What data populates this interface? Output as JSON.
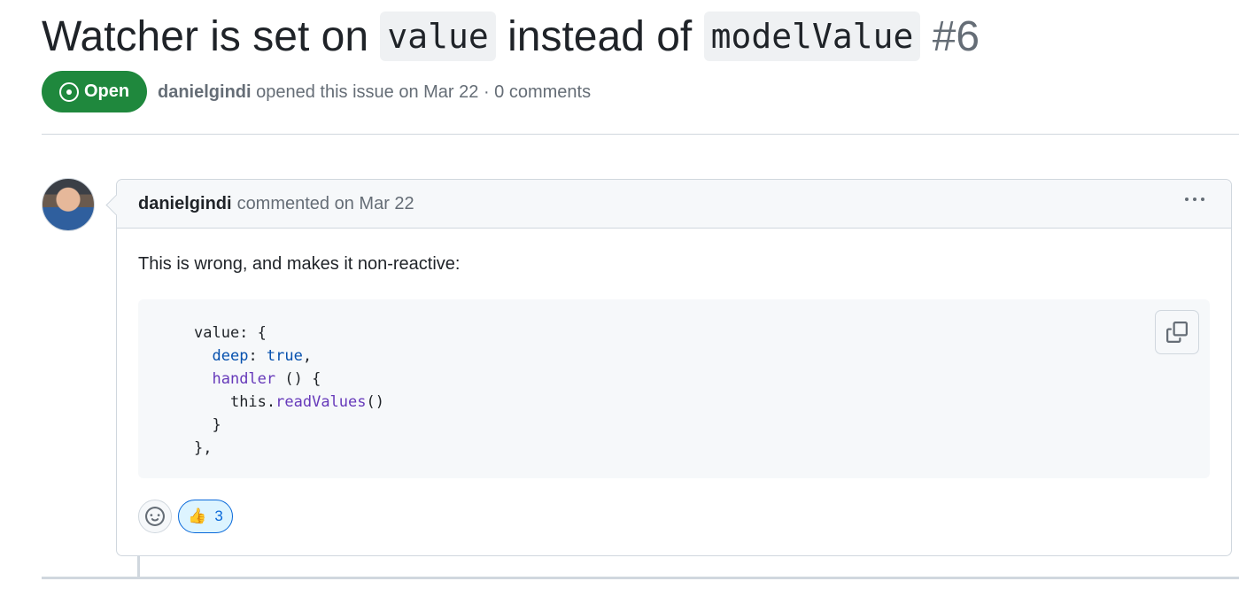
{
  "issue": {
    "title_part1": "Watcher is set on",
    "title_code1": "value",
    "title_part2": "instead of",
    "title_code2": "modelValue",
    "number": "#6",
    "state": "Open",
    "author": "danielgindi",
    "meta_text": "opened this issue on Mar 22 · 0 comments"
  },
  "comment": {
    "author": "danielgindi",
    "meta_text": "commented on Mar 22",
    "body": "This is wrong, and makes it non-reactive:",
    "code": {
      "line1": "value: {",
      "line2_key": "deep",
      "line2_value": "true",
      "line3_key": "handler",
      "line3_rest": " () {",
      "line4_this": "this.",
      "line4_fn": "readValues",
      "line4_rest": "()",
      "line5": "}",
      "line6": "},"
    },
    "reactions": [
      {
        "emoji": "👍",
        "icon": "thumbs-up-icon",
        "count": "3"
      }
    ]
  },
  "icons": {
    "state": "issue-opened-icon",
    "kebab": "kebab-horizontal-icon",
    "copy": "copy-icon",
    "smiley": "smiley-icon"
  },
  "colors": {
    "open_green": "#1f883d",
    "link_blue": "#0969da",
    "reaction_bg": "#ddf4ff",
    "border": "#d0d7de"
  }
}
